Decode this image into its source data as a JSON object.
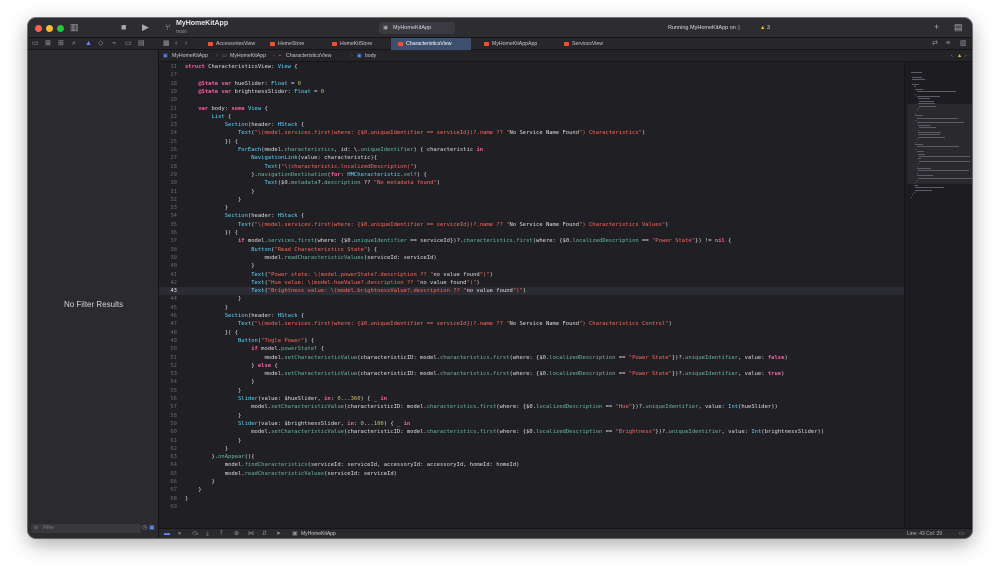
{
  "window": {
    "project_title": "MyHomeKitApp",
    "branch": "main",
    "scheme": "MyHomeKitApp",
    "status": "Running MyHomeKitApp on",
    "warning_count": "3"
  },
  "tabs": [
    {
      "label": "AccessoriesView",
      "active": false
    },
    {
      "label": "HomeStore",
      "active": false
    },
    {
      "label": "HomeKitStore",
      "active": false
    },
    {
      "label": "CharacteristicsView",
      "active": true
    },
    {
      "label": "MyHomeKitAppApp",
      "active": false
    },
    {
      "label": "ServicesView",
      "active": false
    }
  ],
  "breadcrumb": [
    "MyHomeKitApp",
    "MyHomeKitApp",
    "CharacteristicsView",
    "body"
  ],
  "navigator": {
    "empty_text": "No Filter Results",
    "filter_placeholder": "Filter"
  },
  "editor": {
    "current_line": 43,
    "lines": [
      {
        "n": "11",
        "code": "struct CharacteristicsView: View {"
      },
      {
        "n": "17",
        "code": ""
      },
      {
        "n": "18",
        "code": "    @State var hueSlider: Float = 0"
      },
      {
        "n": "19",
        "code": "    @State var brightnessSlider: Float = 0"
      },
      {
        "n": "20",
        "code": ""
      },
      {
        "n": "21",
        "code": "    var body: some View {"
      },
      {
        "n": "22",
        "code": "        List {"
      },
      {
        "n": "23",
        "code": "            Section(header: HStack {"
      },
      {
        "n": "24",
        "code": "                Text(\"\\(model.services.first(where: {$0.uniqueIdentifier == serviceId})?.name ?? \"No Service Name Found\") Characteristics\")"
      },
      {
        "n": "25",
        "code": "            }) {"
      },
      {
        "n": "26",
        "code": "                ForEach(model.characteristics, id: \\.uniqueIdentifier) { characteristic in"
      },
      {
        "n": "27",
        "code": "                    NavigationLink(value: characteristic){"
      },
      {
        "n": "28",
        "code": "                        Text(\"\\(characteristic.localizedDescription)\")"
      },
      {
        "n": "29",
        "code": "                    }.navigationDestination(for: HMCharacteristic.self) {"
      },
      {
        "n": "30",
        "code": "                        Text($0.metadata?.description ?? \"No metadata found\")"
      },
      {
        "n": "31",
        "code": "                    }"
      },
      {
        "n": "32",
        "code": "                }"
      },
      {
        "n": "33",
        "code": "            }"
      },
      {
        "n": "34",
        "code": "            Section(header: HStack {"
      },
      {
        "n": "35",
        "code": "                Text(\"\\(model.services.first(where: {$0.uniqueIdentifier == serviceId})?.name ?? \"No Service Name Found\") Characteristics Values\")"
      },
      {
        "n": "36",
        "code": "            }) {"
      },
      {
        "n": "37",
        "code": "                if model.services.first(where: {$0.uniqueIdentifier == serviceId})?.characteristics.first(where: {$0.localizedDescription == \"Power State\"}) != nil {"
      },
      {
        "n": "38",
        "code": "                    Button(\"Read Characteristics State\") {"
      },
      {
        "n": "39",
        "code": "                        model.readCharacteristicValues(serviceId: serviceId)"
      },
      {
        "n": "40",
        "code": "                    }"
      },
      {
        "n": "41",
        "code": "                    Text(\"Power state: \\(model.powerState?.description ?? \"no value found\")\")"
      },
      {
        "n": "42",
        "code": "                    Text(\"Hue value: \\(model.hueValue?.description ?? \"no value found\")\")"
      },
      {
        "n": "43",
        "code": "                    Text(\"Brightness value: \\(model.brightnessValue?.description ?? \"no value found\")\")"
      },
      {
        "n": "44",
        "code": "                }"
      },
      {
        "n": "45",
        "code": "            }"
      },
      {
        "n": "46",
        "code": "            Section(header: HStack {"
      },
      {
        "n": "47",
        "code": "                Text(\"\\(model.services.first(where: {$0.uniqueIdentifier == serviceId})?.name ?? \"No Service Name Found\") Characteristics Control\")"
      },
      {
        "n": "48",
        "code": "            }) {"
      },
      {
        "n": "49",
        "code": "                Button(\"Togle Power\") {"
      },
      {
        "n": "50",
        "code": "                    if model.powerState! {"
      },
      {
        "n": "51",
        "code": "                        model.setCharacteristicValue(characteristicID: model.characteristics.first(where: {$0.localizedDescription == \"Power State\"})?.uniqueIdentifier, value: false)"
      },
      {
        "n": "52",
        "code": "                    } else {"
      },
      {
        "n": "53",
        "code": "                        model.setCharacteristicValue(characteristicID: model.characteristics.first(where: {$0.localizedDescription == \"Power State\"})?.uniqueIdentifier, value: true)"
      },
      {
        "n": "54",
        "code": "                    }"
      },
      {
        "n": "55",
        "code": "                }"
      },
      {
        "n": "56",
        "code": "                Slider(value: $hueSlider, in: 0...360) { _ in"
      },
      {
        "n": "57",
        "code": "                    model.setCharacteristicValue(characteristicID: model.characteristics.first(where: {$0.localizedDescription == \"Hue\"})?.uniqueIdentifier, value: Int(hueSlider))"
      },
      {
        "n": "58",
        "code": "                }"
      },
      {
        "n": "59",
        "code": "                Slider(value: $brightnessSlider, in: 0...100) { _ in"
      },
      {
        "n": "60",
        "code": "                    model.setCharacteristicValue(characteristicID: model.characteristics.first(where: {$0.localizedDescription == \"Brightness\"})?.uniqueIdentifier, value: Int(brightnessSlider))"
      },
      {
        "n": "61",
        "code": "                }"
      },
      {
        "n": "62",
        "code": "            }"
      },
      {
        "n": "63",
        "code": "        }.onAppear(){"
      },
      {
        "n": "64",
        "code": "            model.findCharacteristics(serviceId: serviceId, accessoryId: accessoryId, homeId: homeId)"
      },
      {
        "n": "65",
        "code": "            model.readCharacteristicValues(serviceId: serviceId)"
      },
      {
        "n": "66",
        "code": "        }"
      },
      {
        "n": "67",
        "code": "    }"
      },
      {
        "n": "68",
        "code": "}"
      },
      {
        "n": "69",
        "code": ""
      }
    ]
  },
  "debugbar": {
    "target": "MyHomeKitApp",
    "position": "Line: 43  Col: 29"
  },
  "colors": {
    "close": "#ff5f57",
    "minimize": "#febc2e",
    "zoom": "#28c840",
    "keyword": "#fc5fa3",
    "type": "#5dd8ff",
    "string": "#fc6a5d",
    "number": "#d0bf69",
    "active_tab": "#3d4f6e"
  }
}
